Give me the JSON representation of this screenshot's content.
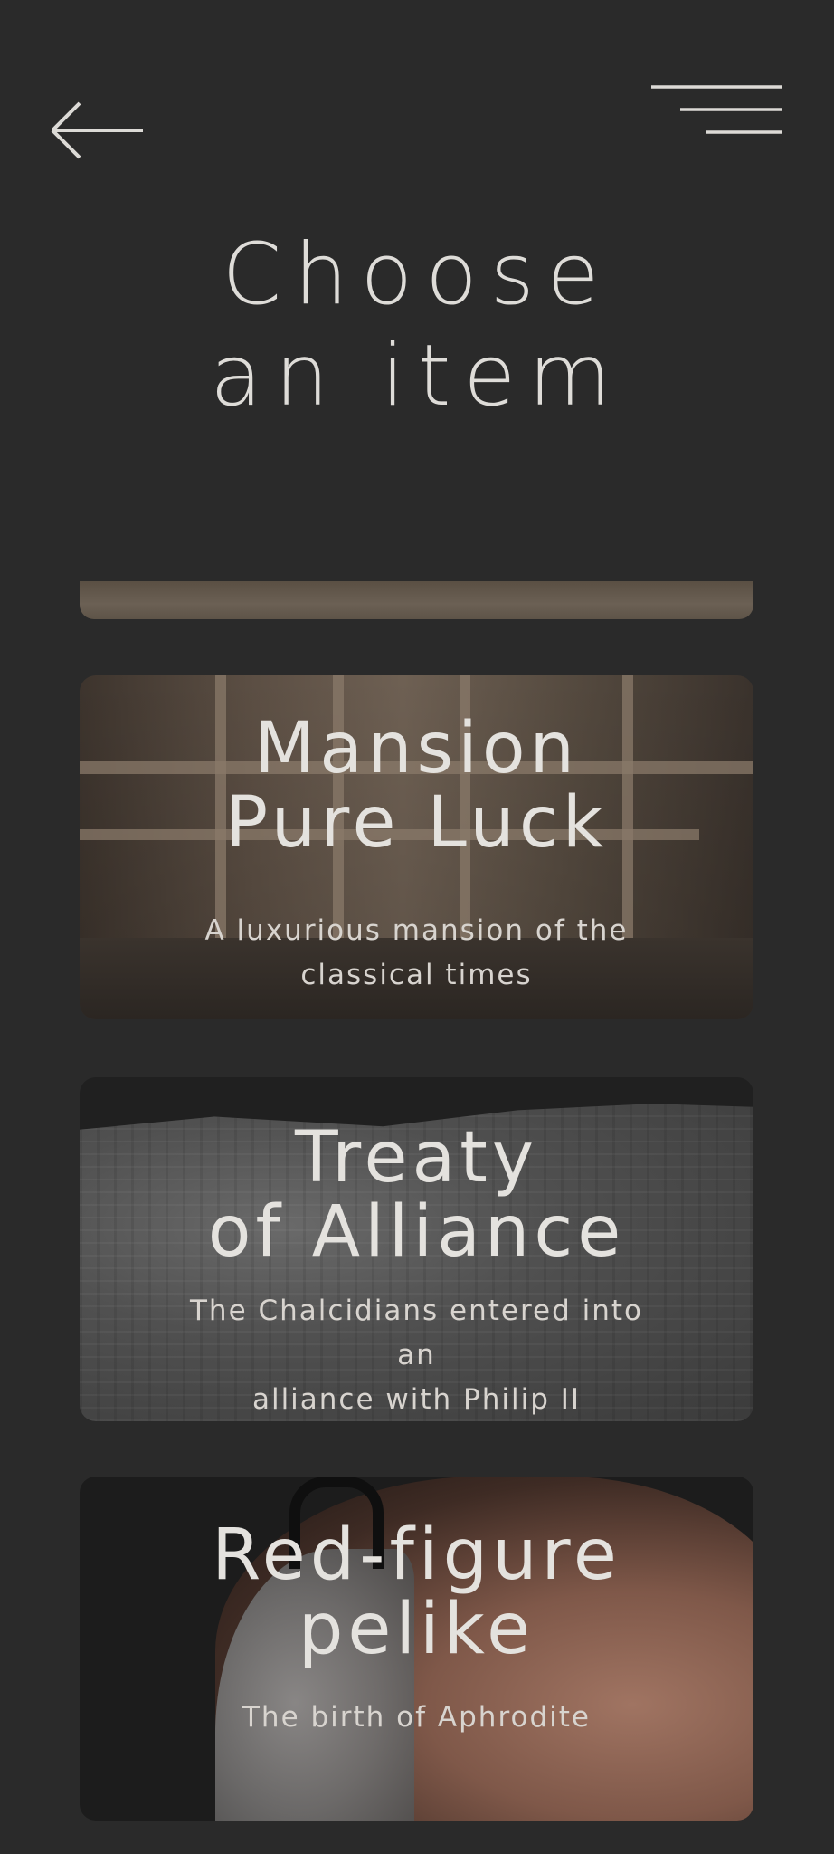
{
  "header": {
    "back_icon": "arrow-left-icon",
    "menu_icon": "hamburger-menu-icon"
  },
  "page": {
    "title_line1": "Choose",
    "title_line2": "an item"
  },
  "items": [
    {
      "title": "Mansion\nPure Luck",
      "description": "A luxurious mansion of the\nclassical times"
    },
    {
      "title": "Treaty\nof Alliance",
      "description": "The Chalcidians entered into\nan\nalliance with Philip II"
    },
    {
      "title": "Red-figure\npelike",
      "description": "The birth of Aphrodite"
    }
  ],
  "colors": {
    "background": "#2a2a2a",
    "text": "#e2e0dc"
  }
}
